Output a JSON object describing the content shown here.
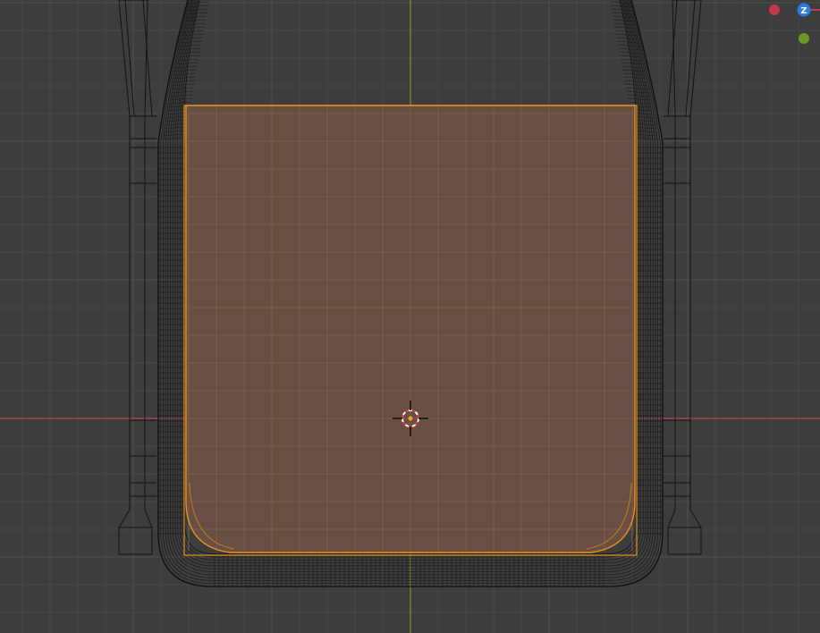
{
  "viewport": {
    "background": "#3d3d3d",
    "grid_minor_color": "#454545",
    "grid_major_color": "#505050",
    "x_axis_color": "#c24a5e",
    "y_axis_color": "#7ea51f",
    "wire_color": "#141414",
    "selected_edge_color": "#e8901c",
    "selected_face_fill": "#6b4f43"
  },
  "gizmo": {
    "z_label": "Z",
    "z_color": "#2e7be0",
    "x_color": "#c0394c",
    "y_color": "#6a9a22"
  },
  "cursor_3d": {
    "ring_red": "#e04040",
    "ring_white": "#ffffff",
    "origin_color": "#f0a020"
  }
}
